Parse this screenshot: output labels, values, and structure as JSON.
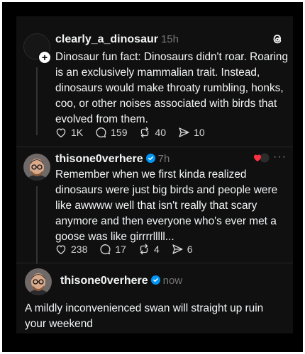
{
  "post1": {
    "username": "clearly_a_dinosaur",
    "time": "15h",
    "text": "Dinosaur fun fact: Dinosaurs didn't roar. Roaring is an exclusively mammalian trait. Instead, dinosaurs would make throaty rumbling, honks, coo, or other noises associated with birds that evolved from them.",
    "likes": "1K",
    "replies": "159",
    "reposts": "40",
    "shares": "10"
  },
  "post2": {
    "username": "thisone0verhere",
    "time": "7h",
    "text": "Remember when we first kinda realized dinosaurs were just big birds and people were like awwww well that isn't really that scary anymore and then everyone who's ever met a goose was like girrrrlllll...",
    "likes": "238",
    "replies": "17",
    "reposts": "4",
    "shares": "6"
  },
  "post3": {
    "username": "thisone0verhere",
    "time": "now",
    "text": "A mildly inconvenienced swan will straight up ruin your weekend"
  },
  "colors": {
    "background": "#101010",
    "text": "#f3f5f7",
    "muted": "#777777",
    "verified": "#0095f6",
    "heart": "#ff3040"
  },
  "icons": [
    "threads-logo-icon",
    "heart-icon",
    "comment-icon",
    "repost-icon",
    "share-icon",
    "verified-badge-icon",
    "more-icon",
    "follow-plus-icon"
  ]
}
